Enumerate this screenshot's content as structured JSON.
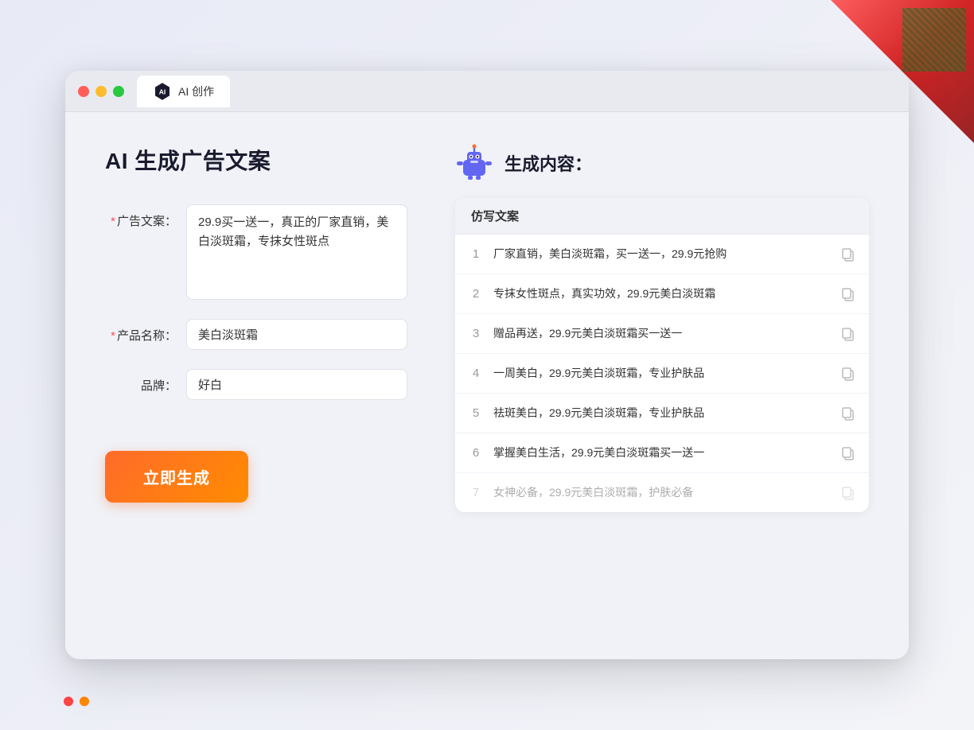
{
  "window": {
    "title": "AI 创作",
    "controls": {
      "close": "●",
      "minimize": "●",
      "maximize": "●"
    }
  },
  "left_panel": {
    "title": "AI 生成广告文案",
    "form": {
      "ad_copy_label": "广告文案：",
      "ad_copy_required": "*",
      "ad_copy_value": "29.9买一送一，真正的厂家直销，美白淡斑霜，专抹女性斑点",
      "product_name_label": "产品名称：",
      "product_name_required": "*",
      "product_name_value": "美白淡斑霜",
      "brand_label": "品牌：",
      "brand_value": "好白"
    },
    "generate_button": "立即生成"
  },
  "right_panel": {
    "title": "生成内容：",
    "table_header": "仿写文案",
    "results": [
      {
        "num": 1,
        "text": "厂家直销，美白淡斑霜，买一送一，29.9元抢购"
      },
      {
        "num": 2,
        "text": "专抹女性斑点，真实功效，29.9元美白淡斑霜"
      },
      {
        "num": 3,
        "text": "赠品再送，29.9元美白淡斑霜买一送一"
      },
      {
        "num": 4,
        "text": "一周美白，29.9元美白淡斑霜，专业护肤品"
      },
      {
        "num": 5,
        "text": "祛斑美白，29.9元美白淡斑霜，专业护肤品"
      },
      {
        "num": 6,
        "text": "掌握美白生活，29.9元美白淡斑霜买一送一"
      },
      {
        "num": 7,
        "text": "女神必备，29.9元美白淡斑霜，护肤必备",
        "faded": true
      }
    ]
  }
}
